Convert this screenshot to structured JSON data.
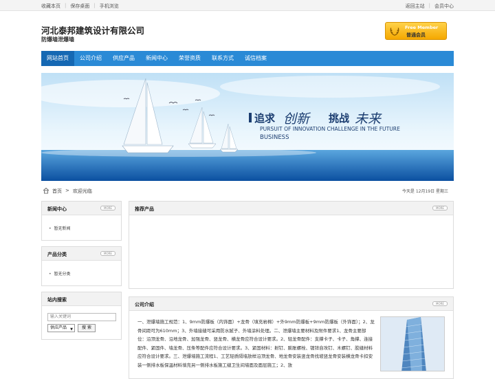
{
  "topbar": {
    "left": [
      "收藏本页",
      "保存桌面",
      "手机浏览"
    ],
    "right": [
      "返回主站",
      "会员中心"
    ]
  },
  "header": {
    "company": "河北泰邦建筑设计有限公司",
    "subtitle": "防爆墙泄爆墙",
    "member_en": "Free Member",
    "member_cn": "普通会员"
  },
  "nav": [
    "网站首页",
    "公司介绍",
    "供应产品",
    "新闻中心",
    "荣誉资质",
    "联系方式",
    "诚信档案"
  ],
  "banner": {
    "slogan_a": "追求",
    "slogan_b": "创新",
    "slogan_c": "挑战",
    "slogan_d": "未来",
    "en_line1": "PURSUIT OF INNOVATION CHALLENGE IN THE FUTURE",
    "en_line2": "BUSINESS"
  },
  "breadcrumb": {
    "home": "首页",
    "sep": ">",
    "current": "欢迎光临",
    "date": "今天是 12月19日 星期三"
  },
  "sidebar": {
    "news": {
      "title": "新闻中心",
      "more": "MORE",
      "item": "暂无新闻"
    },
    "category": {
      "title": "产品分类",
      "more": "MORE",
      "item": "暂无分类"
    },
    "search": {
      "title": "站内搜索",
      "placeholder": "输入关键词",
      "select": "供应产品",
      "button": "搜 索"
    }
  },
  "main": {
    "recommend": {
      "title": "推荐产品",
      "more": "MORE"
    },
    "intro": {
      "title": "公司介绍",
      "more": "MORE",
      "text": "一、泄爆墙施工规范：1、9mm防爆板（内饰面）+龙骨（填充岩棉）+外9mm防爆板+9mm防爆板（外饰面）；2、龙骨间距可为610mm；3、外墙接缝可采用防水腻子、外墙涂料处理。二、泄爆墙主要材料及附件要求1、龙骨主要部位：沿顶龙骨、沿地龙骨、加强龙骨、竖龙骨、横龙骨应符合设计要求。2、轻龙骨配件：支撑卡子、卡子、角撑、连接配件、紧固件、墙龙骨、压条等配件应符合设计要求。3、紧固材料：射钉、膨胀螺栓、镀锌自攻钉、木螺钉、胶缝材料应符合设计要求。三、泄爆墙施工流程1、工艺轻质隔墙放样沿顶龙骨、地龙骨安装竖龙骨找坡竖龙骨安装横龙骨卡扣安装一侧排水板保温材料填充另一侧排水板施工缝卫生间墙面及面层施工；2、放"
    }
  },
  "colors": {
    "nav": "#2a8ad6",
    "nav_active": "#1568b3",
    "gold": "#f5a800"
  }
}
